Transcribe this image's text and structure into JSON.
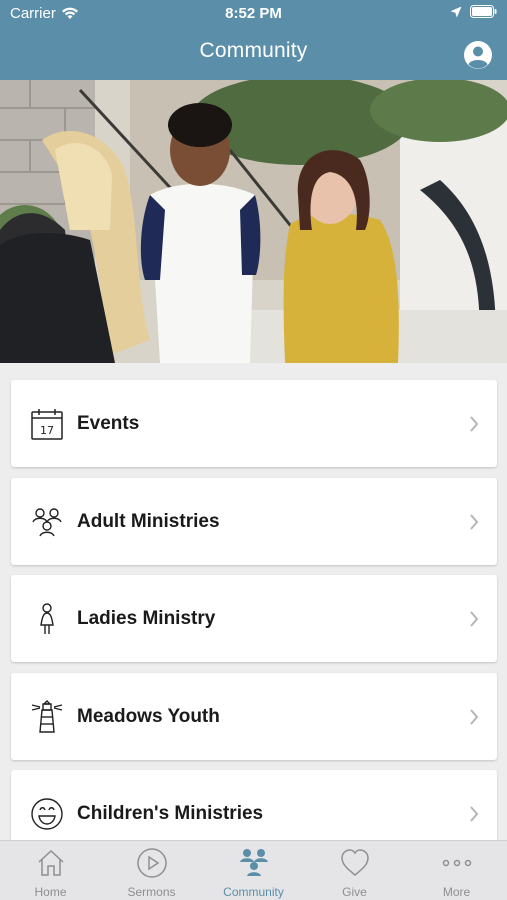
{
  "status_bar": {
    "carrier": "Carrier",
    "time": "8:52 PM"
  },
  "header": {
    "title": "Community"
  },
  "menu": [
    {
      "label": "Events",
      "icon": "calendar-icon",
      "calendar_day": "17"
    },
    {
      "label": "Adult Ministries",
      "icon": "adults-icon"
    },
    {
      "label": "Ladies Ministry",
      "icon": "woman-icon"
    },
    {
      "label": "Meadows Youth",
      "icon": "lighthouse-icon"
    },
    {
      "label": "Children's Ministries",
      "icon": "smiley-icon"
    }
  ],
  "tabs": [
    {
      "label": "Home",
      "icon": "home-icon"
    },
    {
      "label": "Sermons",
      "icon": "play-icon"
    },
    {
      "label": "Community",
      "icon": "community-icon",
      "active": true
    },
    {
      "label": "Give",
      "icon": "heart-icon"
    },
    {
      "label": "More",
      "icon": "more-icon"
    }
  ],
  "colors": {
    "accent": "#5b8ea9",
    "background": "#ededee",
    "tab_inactive": "#8e8e93"
  }
}
